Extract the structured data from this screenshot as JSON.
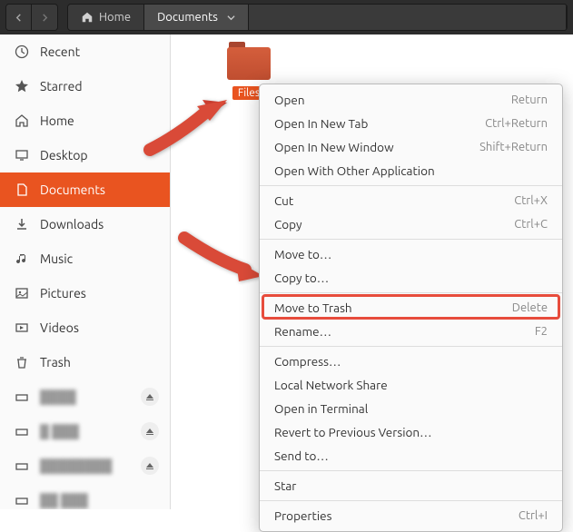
{
  "titlebar": {
    "crumbs": [
      {
        "label": "Home",
        "icon": "home"
      },
      {
        "label": "Documents",
        "active": true
      }
    ]
  },
  "sidebar": {
    "items": [
      {
        "label": "Recent",
        "icon": "clock"
      },
      {
        "label": "Starred",
        "icon": "star"
      },
      {
        "label": "Home",
        "icon": "home"
      },
      {
        "label": "Desktop",
        "icon": "desktop"
      },
      {
        "label": "Documents",
        "icon": "file",
        "active": true
      },
      {
        "label": "Downloads",
        "icon": "download"
      },
      {
        "label": "Music",
        "icon": "music"
      },
      {
        "label": "Pictures",
        "icon": "picture"
      },
      {
        "label": "Videos",
        "icon": "video"
      },
      {
        "label": "Trash",
        "icon": "trash"
      }
    ],
    "mounts": [
      {
        "hidden": true
      },
      {
        "hidden": true
      },
      {
        "hidden": true
      },
      {
        "hidden": true
      }
    ]
  },
  "folder": {
    "name": "Files"
  },
  "menu": {
    "groups": [
      [
        {
          "label": "Open",
          "shortcut": "Return"
        },
        {
          "label": "Open In New Tab",
          "shortcut": "Ctrl+Return"
        },
        {
          "label": "Open In New Window",
          "shortcut": "Shift+Return"
        },
        {
          "label": "Open With Other Application",
          "shortcut": ""
        }
      ],
      [
        {
          "label": "Cut",
          "shortcut": "Ctrl+X"
        },
        {
          "label": "Copy",
          "shortcut": "Ctrl+C"
        }
      ],
      [
        {
          "label": "Move to…",
          "shortcut": ""
        },
        {
          "label": "Copy to…",
          "shortcut": ""
        }
      ],
      [
        {
          "label": "Move to Trash",
          "shortcut": "Delete",
          "highlight": true
        },
        {
          "label": "Rename…",
          "shortcut": "F2"
        }
      ],
      [
        {
          "label": "Compress…",
          "shortcut": ""
        },
        {
          "label": "Local Network Share",
          "shortcut": ""
        },
        {
          "label": "Open in Terminal",
          "shortcut": ""
        },
        {
          "label": "Revert to Previous Version…",
          "shortcut": ""
        },
        {
          "label": "Send to…",
          "shortcut": ""
        }
      ],
      [
        {
          "label": "Star",
          "shortcut": ""
        }
      ],
      [
        {
          "label": "Properties",
          "shortcut": "Ctrl+I"
        }
      ]
    ]
  }
}
